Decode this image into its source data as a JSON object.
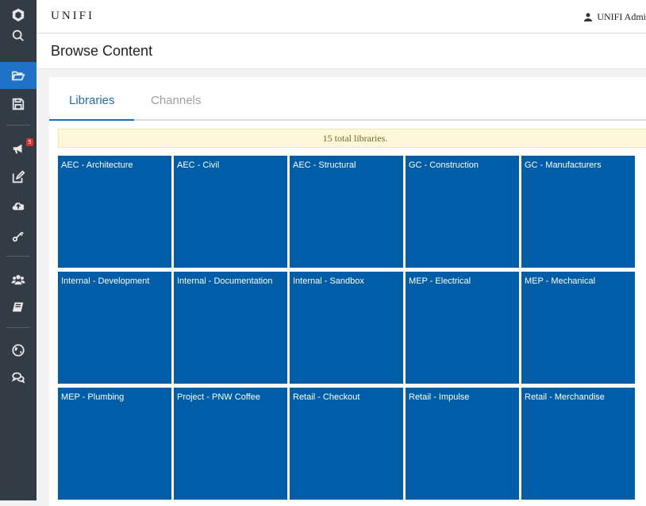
{
  "app": {
    "brand": "UNIFI",
    "user_label": "UNIFI Admi"
  },
  "page": {
    "title": "Browse Content"
  },
  "tabs": [
    {
      "label": "Libraries",
      "active": true
    },
    {
      "label": "Channels",
      "active": false
    }
  ],
  "banner": {
    "text": "15 total libraries."
  },
  "sidebar": {
    "items": [
      {
        "icon": "logo-icon"
      },
      {
        "icon": "search-icon"
      },
      {
        "icon": "folder-open-icon",
        "active": true
      },
      {
        "icon": "save-icon"
      },
      {
        "icon": "megaphone-icon",
        "badge": "5"
      },
      {
        "icon": "edit-icon"
      },
      {
        "icon": "cloud-upload-icon"
      },
      {
        "icon": "key-icon"
      },
      {
        "icon": "users-icon"
      },
      {
        "icon": "book-icon"
      },
      {
        "icon": "globe-icon"
      },
      {
        "icon": "chat-icon"
      }
    ]
  },
  "libraries": [
    {
      "name": "AEC - Architecture"
    },
    {
      "name": "AEC - Civil"
    },
    {
      "name": "AEC - Structural"
    },
    {
      "name": "GC - Construction"
    },
    {
      "name": "GC - Manufacturers"
    },
    {
      "name": "Internal - Development"
    },
    {
      "name": "Internal - Documentation"
    },
    {
      "name": "Internal - Sandbox"
    },
    {
      "name": "MEP - Electrical"
    },
    {
      "name": "MEP - Mechanical"
    },
    {
      "name": "MEP - Plumbing"
    },
    {
      "name": "Project - PNW Coffee"
    },
    {
      "name": "Retail - Checkout"
    },
    {
      "name": "Retail - Impulse"
    },
    {
      "name": "Retail - Merchandise"
    }
  ],
  "colors": {
    "sidebar_bg": "#333b44",
    "active_nav": "#1e73c8",
    "tile_bg": "#005ea8",
    "tab_active": "#1e6db5",
    "banner_bg": "#fcf8d8",
    "badge": "#d9342b"
  }
}
